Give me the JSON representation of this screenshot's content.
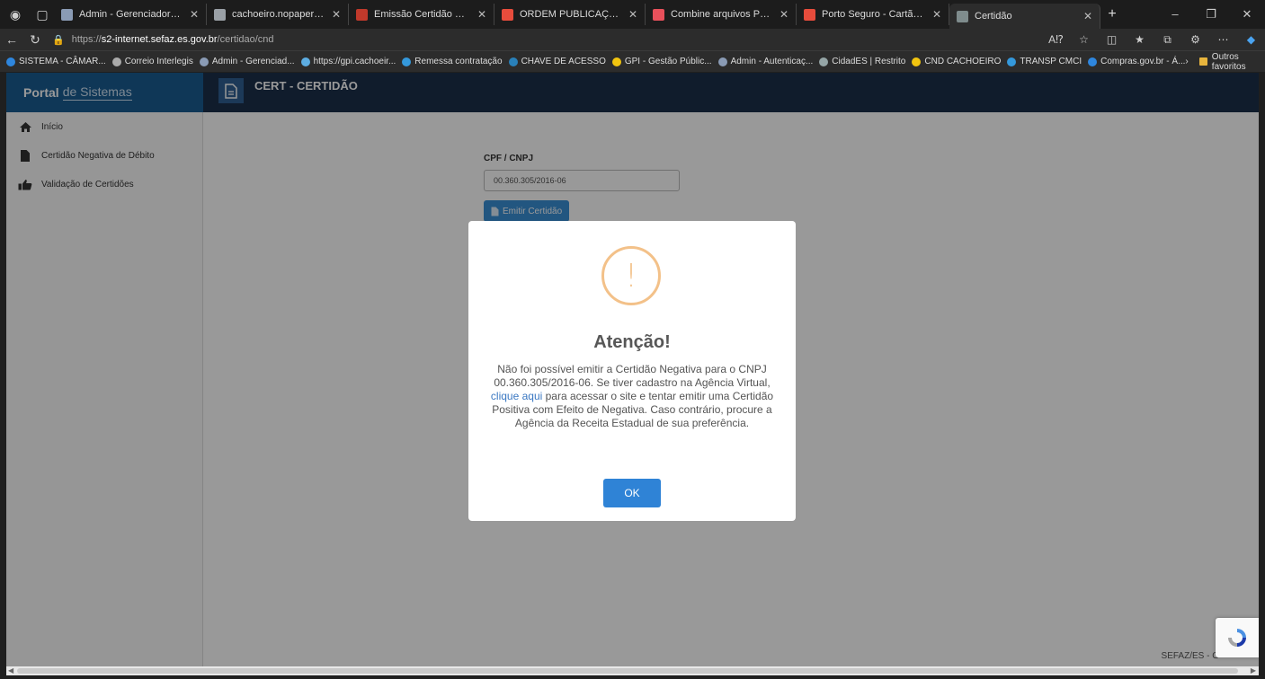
{
  "browser": {
    "tabs": [
      {
        "title": "Admin - Gerenciador de Conte",
        "favicon_color": "#8a9bb5",
        "active": false
      },
      {
        "title": "cachoeiro.nopapercloud.com.b",
        "favicon_color": "#9aa0a6",
        "active": false
      },
      {
        "title": "Emissão Certidão Negativa",
        "favicon_color": "#c0392b",
        "active": false
      },
      {
        "title": "ORDEM PUBLICAÇÕES.pdf",
        "favicon_color": "#e74c3c",
        "active": false
      },
      {
        "title": "Combine arquivos PDF online.",
        "favicon_color": "#e8505b",
        "active": false
      },
      {
        "title": "Porto Seguro - Cartão CNPJ.pdf",
        "favicon_color": "#e74c3c",
        "active": false
      },
      {
        "title": "Certidão",
        "favicon_color": "#7f8c8d",
        "active": true
      }
    ],
    "url": {
      "scheme": "https://",
      "domain": "s2-internet.sefaz.es.gov.br",
      "path": "/certidao/cnd"
    },
    "bookmarks": [
      {
        "label": "SISTEMA - CÂMAR...",
        "color": "#2e86de"
      },
      {
        "label": "Correio Interlegis",
        "color": "#aaaaaa"
      },
      {
        "label": "Admin - Gerenciad...",
        "color": "#8a9bb5"
      },
      {
        "label": "https://gpi.cachoeir...",
        "color": "#5dade2"
      },
      {
        "label": "Remessa contratação",
        "color": "#3498db"
      },
      {
        "label": "CHAVE DE ACESSO",
        "color": "#2980b9"
      },
      {
        "label": "GPI - Gestão Públic...",
        "color": "#f1c40f"
      },
      {
        "label": "Admin - Autenticaç...",
        "color": "#8a9bb5"
      },
      {
        "label": "CidadES | Restrito",
        "color": "#95a5a6"
      },
      {
        "label": "CND CACHOEIRO",
        "color": "#f1c40f"
      },
      {
        "label": "TRANSP CMCI",
        "color": "#3498db"
      },
      {
        "label": "Compras.gov.br - Á...",
        "color": "#2e86de"
      }
    ],
    "bookmarks_more": "Outros favoritos"
  },
  "app": {
    "brand_bold": "Portal",
    "brand_rest": "de Sistemas",
    "page_title": "CERT - CERTIDÃO",
    "sidebar": [
      {
        "label": "Início",
        "icon": "home-icon"
      },
      {
        "label": "Certidão Negativa de Débito",
        "icon": "document-icon"
      },
      {
        "label": "Validação de Certidões",
        "icon": "thumbs-up-icon"
      }
    ],
    "form": {
      "label": "CPF / CNPJ",
      "value": "00.360.305/2016-06",
      "button": "Emitir Certidão"
    },
    "footer": "SEFAZ/ES - G"
  },
  "modal": {
    "title": "Atenção!",
    "text_before": "Não foi possível emitir a Certidão Negativa para o CNPJ 00.360.305/2016-06. Se tiver cadastro na Agência Virtual,",
    "link": "clique aqui",
    "text_after": "para acessar o site e tentar emitir uma Certidão Positiva com Efeito de Negativa. Caso contrário, procure a Agência da Receita Estadual de sua preferência.",
    "ok": "OK",
    "icon": "warning-icon",
    "icon_color": "#f3c189"
  }
}
